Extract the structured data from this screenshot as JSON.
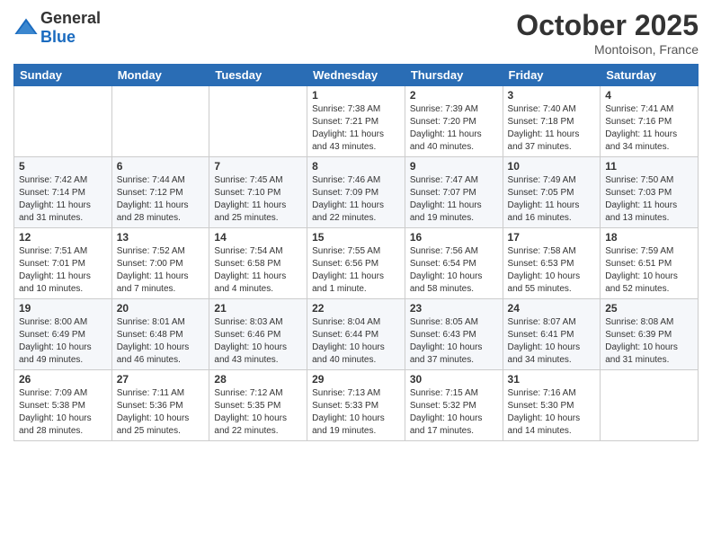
{
  "header": {
    "logo_general": "General",
    "logo_blue": "Blue",
    "month": "October 2025",
    "location": "Montoison, France"
  },
  "weekdays": [
    "Sunday",
    "Monday",
    "Tuesday",
    "Wednesday",
    "Thursday",
    "Friday",
    "Saturday"
  ],
  "weeks": [
    [
      {
        "day": "",
        "info": ""
      },
      {
        "day": "",
        "info": ""
      },
      {
        "day": "",
        "info": ""
      },
      {
        "day": "1",
        "info": "Sunrise: 7:38 AM\nSunset: 7:21 PM\nDaylight: 11 hours\nand 43 minutes."
      },
      {
        "day": "2",
        "info": "Sunrise: 7:39 AM\nSunset: 7:20 PM\nDaylight: 11 hours\nand 40 minutes."
      },
      {
        "day": "3",
        "info": "Sunrise: 7:40 AM\nSunset: 7:18 PM\nDaylight: 11 hours\nand 37 minutes."
      },
      {
        "day": "4",
        "info": "Sunrise: 7:41 AM\nSunset: 7:16 PM\nDaylight: 11 hours\nand 34 minutes."
      }
    ],
    [
      {
        "day": "5",
        "info": "Sunrise: 7:42 AM\nSunset: 7:14 PM\nDaylight: 11 hours\nand 31 minutes."
      },
      {
        "day": "6",
        "info": "Sunrise: 7:44 AM\nSunset: 7:12 PM\nDaylight: 11 hours\nand 28 minutes."
      },
      {
        "day": "7",
        "info": "Sunrise: 7:45 AM\nSunset: 7:10 PM\nDaylight: 11 hours\nand 25 minutes."
      },
      {
        "day": "8",
        "info": "Sunrise: 7:46 AM\nSunset: 7:09 PM\nDaylight: 11 hours\nand 22 minutes."
      },
      {
        "day": "9",
        "info": "Sunrise: 7:47 AM\nSunset: 7:07 PM\nDaylight: 11 hours\nand 19 minutes."
      },
      {
        "day": "10",
        "info": "Sunrise: 7:49 AM\nSunset: 7:05 PM\nDaylight: 11 hours\nand 16 minutes."
      },
      {
        "day": "11",
        "info": "Sunrise: 7:50 AM\nSunset: 7:03 PM\nDaylight: 11 hours\nand 13 minutes."
      }
    ],
    [
      {
        "day": "12",
        "info": "Sunrise: 7:51 AM\nSunset: 7:01 PM\nDaylight: 11 hours\nand 10 minutes."
      },
      {
        "day": "13",
        "info": "Sunrise: 7:52 AM\nSunset: 7:00 PM\nDaylight: 11 hours\nand 7 minutes."
      },
      {
        "day": "14",
        "info": "Sunrise: 7:54 AM\nSunset: 6:58 PM\nDaylight: 11 hours\nand 4 minutes."
      },
      {
        "day": "15",
        "info": "Sunrise: 7:55 AM\nSunset: 6:56 PM\nDaylight: 11 hours\nand 1 minute."
      },
      {
        "day": "16",
        "info": "Sunrise: 7:56 AM\nSunset: 6:54 PM\nDaylight: 10 hours\nand 58 minutes."
      },
      {
        "day": "17",
        "info": "Sunrise: 7:58 AM\nSunset: 6:53 PM\nDaylight: 10 hours\nand 55 minutes."
      },
      {
        "day": "18",
        "info": "Sunrise: 7:59 AM\nSunset: 6:51 PM\nDaylight: 10 hours\nand 52 minutes."
      }
    ],
    [
      {
        "day": "19",
        "info": "Sunrise: 8:00 AM\nSunset: 6:49 PM\nDaylight: 10 hours\nand 49 minutes."
      },
      {
        "day": "20",
        "info": "Sunrise: 8:01 AM\nSunset: 6:48 PM\nDaylight: 10 hours\nand 46 minutes."
      },
      {
        "day": "21",
        "info": "Sunrise: 8:03 AM\nSunset: 6:46 PM\nDaylight: 10 hours\nand 43 minutes."
      },
      {
        "day": "22",
        "info": "Sunrise: 8:04 AM\nSunset: 6:44 PM\nDaylight: 10 hours\nand 40 minutes."
      },
      {
        "day": "23",
        "info": "Sunrise: 8:05 AM\nSunset: 6:43 PM\nDaylight: 10 hours\nand 37 minutes."
      },
      {
        "day": "24",
        "info": "Sunrise: 8:07 AM\nSunset: 6:41 PM\nDaylight: 10 hours\nand 34 minutes."
      },
      {
        "day": "25",
        "info": "Sunrise: 8:08 AM\nSunset: 6:39 PM\nDaylight: 10 hours\nand 31 minutes."
      }
    ],
    [
      {
        "day": "26",
        "info": "Sunrise: 7:09 AM\nSunset: 5:38 PM\nDaylight: 10 hours\nand 28 minutes."
      },
      {
        "day": "27",
        "info": "Sunrise: 7:11 AM\nSunset: 5:36 PM\nDaylight: 10 hours\nand 25 minutes."
      },
      {
        "day": "28",
        "info": "Sunrise: 7:12 AM\nSunset: 5:35 PM\nDaylight: 10 hours\nand 22 minutes."
      },
      {
        "day": "29",
        "info": "Sunrise: 7:13 AM\nSunset: 5:33 PM\nDaylight: 10 hours\nand 19 minutes."
      },
      {
        "day": "30",
        "info": "Sunrise: 7:15 AM\nSunset: 5:32 PM\nDaylight: 10 hours\nand 17 minutes."
      },
      {
        "day": "31",
        "info": "Sunrise: 7:16 AM\nSunset: 5:30 PM\nDaylight: 10 hours\nand 14 minutes."
      },
      {
        "day": "",
        "info": ""
      }
    ]
  ]
}
